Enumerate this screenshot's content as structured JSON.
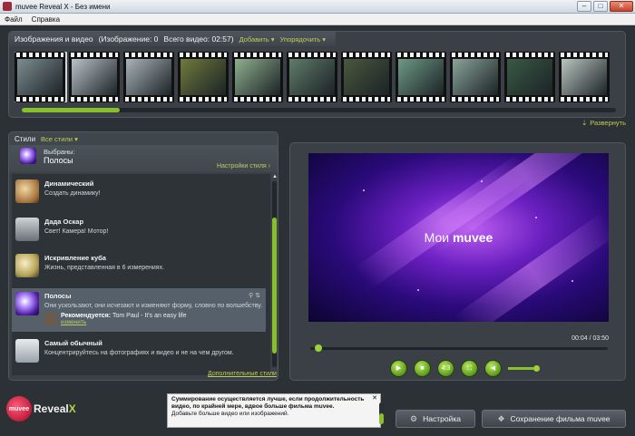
{
  "window": {
    "title": "muvee Reveal X - Без имени",
    "minimize": "–",
    "maximize": "□",
    "close": "✕"
  },
  "menu": [
    "Файл",
    "Справка"
  ],
  "media": {
    "title": "Изображения и видео",
    "image_count_label": "(Изображение: 0",
    "total_video_label": "Всего видео: 02:57)",
    "add_label": "Добавить",
    "sort_label": "Упорядочить",
    "expand_label": "Развернуть",
    "thumbnails": [
      {
        "color": "#7c8e92"
      },
      {
        "color": "#b8c2c8"
      },
      {
        "color": "#a9b4b8"
      },
      {
        "color": "#6f7a3c"
      },
      {
        "color": "#8fb08e"
      },
      {
        "color": "#5f7c6a"
      },
      {
        "color": "#49583f"
      },
      {
        "color": "#6e9a86"
      },
      {
        "color": "#8aa49a"
      },
      {
        "color": "#395a45"
      },
      {
        "color": "#b9c6c0"
      }
    ]
  },
  "styles": {
    "tab_label": "Стили",
    "all_styles_label": "Все стили",
    "selected_label": "Выбраны:",
    "selected_name": "Полосы",
    "settings_label": "Настройки стиля",
    "more_styles_label": "Дополнительные стили",
    "items": [
      {
        "name": "Динамический",
        "desc": "Создать динамику!"
      },
      {
        "name": "Дада Оскар",
        "desc": "Свет! Камера! Мотор!"
      },
      {
        "name": "Искривление куба",
        "desc": "Жизнь, представленная в 6 измерениях."
      },
      {
        "name": "Полосы",
        "desc": "Они ускользают, они исчезают и изменяют форму, словно по волшебству.",
        "recommend_label": "Рекомендуется:",
        "recommend_value": "Tom Paul - It's an easy life",
        "change_label": "изменить"
      },
      {
        "name": "Самый обычный",
        "desc": "Концентрируйтесь на фотографиях и видео и не на чем другом."
      }
    ]
  },
  "preview": {
    "caption_prefix": "Мои",
    "caption_brand": "muvee",
    "timecode": "00:04 / 03:50",
    "progress": 0.02,
    "aspect_label": "4:3"
  },
  "tip": {
    "line1": "Суммирование осуществляется лучше, если продолжительность видео, по крайней мере, вдвое больше фильма muvee.",
    "line2": "Добавьте больше видео или изображений."
  },
  "logo": {
    "badge": "muvee",
    "brand": "Reveal",
    "brand_suffix": "X"
  },
  "buttons": {
    "settings": "Настройка",
    "save": "Сохранение фильма muvee"
  }
}
